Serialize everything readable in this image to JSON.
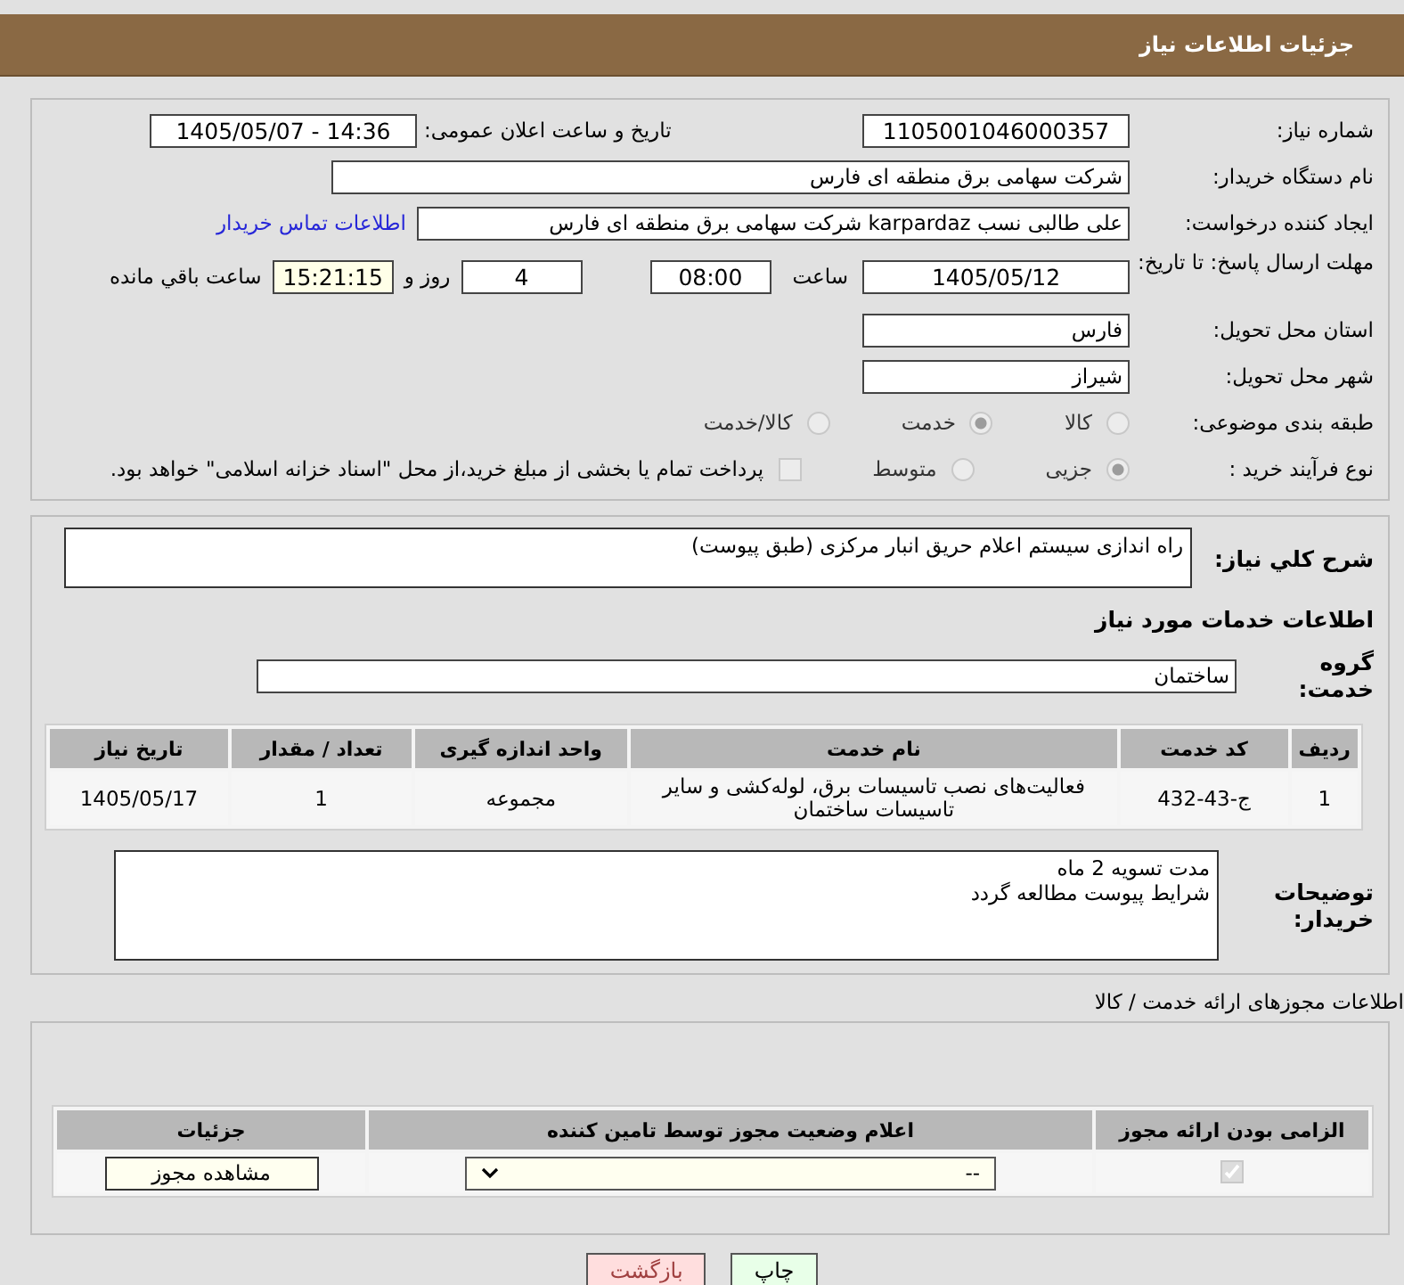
{
  "header": {
    "title": "جزئیات اطلاعات نیاز"
  },
  "need_info": {
    "need_number": {
      "label": "شماره نیاز:",
      "value": "1105001046000357"
    },
    "announce": {
      "label": "تاریخ و ساعت اعلان عمومی:",
      "value": "1405/05/07 - 14:36"
    },
    "buyer_org": {
      "label": "نام دستگاه خریدار:",
      "value": "شرکت سهامی برق منطقه ای فارس"
    },
    "creator": {
      "label": "ایجاد کننده درخواست:",
      "value": "علی طالبی نسب karpardaz شرکت سهامی برق منطقه ای فارس",
      "link": "اطلاعات تماس خریدار"
    },
    "deadline": {
      "label": "مهلت ارسال پاسخ: تا تاریخ:",
      "date": "1405/05/12",
      "time_label": "ساعت",
      "time": "08:00",
      "days": "4",
      "days_label": "روز و",
      "remaining": "15:21:15",
      "remaining_label": "ساعت باقي مانده"
    },
    "province": {
      "label": "استان محل تحویل:",
      "value": "فارس"
    },
    "city": {
      "label": "شهر محل تحویل:",
      "value": "شیراز"
    },
    "category": {
      "label": "طبقه بندی موضوعی:",
      "options": [
        {
          "label": "کالا",
          "selected": false
        },
        {
          "label": "خدمت",
          "selected": true
        },
        {
          "label": "کالا/خدمت",
          "selected": false
        }
      ]
    },
    "process": {
      "label": "نوع فرآیند خرید :",
      "options": [
        {
          "label": "جزیی",
          "selected": true
        },
        {
          "label": "متوسط",
          "selected": false
        }
      ],
      "payment": {
        "label": "پرداخت تمام یا بخشی از مبلغ خرید،از محل \"اسناد خزانه اسلامی\" خواهد بود.",
        "checked": false
      }
    }
  },
  "description": {
    "label": "شرح کلي نیاز:",
    "value": "راه اندازی سیستم اعلام حریق انبار مرکزی  (طبق پیوست)"
  },
  "services": {
    "heading": "اطلاعات خدمات مورد نیاز",
    "group_label": "گروه خدمت:",
    "group_value": "ساختمان",
    "table": {
      "columns": [
        "ردیف",
        "کد خدمت",
        "نام خدمت",
        "واحد اندازه گیری",
        "تعداد / مقدار",
        "تاریخ نیاز"
      ],
      "rows": [
        [
          "1",
          "ج-43-432",
          "فعالیت‌های نصب تاسیسات برق، لوله‌کشی و سایر تاسیسات ساختمان",
          "مجموعه",
          "1",
          "1405/05/17"
        ]
      ]
    }
  },
  "buyer_notes": {
    "label": "توضیحات خریدار:",
    "lines": [
      "مدت تسویه 2 ماه",
      "شرایط پیوست مطالعه گردد"
    ]
  },
  "licenses": {
    "heading": "اطلاعات مجوزهای ارائه خدمت / کالا",
    "columns": [
      "الزامی بودن ارائه مجوز",
      "اعلام وضعیت مجوز توسط تامین کننده",
      "جزئیات"
    ],
    "rows": [
      {
        "required": true,
        "status": "--",
        "details_button": "مشاهده مجوز"
      }
    ]
  },
  "buttons": [
    {
      "kind": "print",
      "label": "چاپ"
    },
    {
      "kind": "back",
      "label": "بازگشت"
    }
  ]
}
